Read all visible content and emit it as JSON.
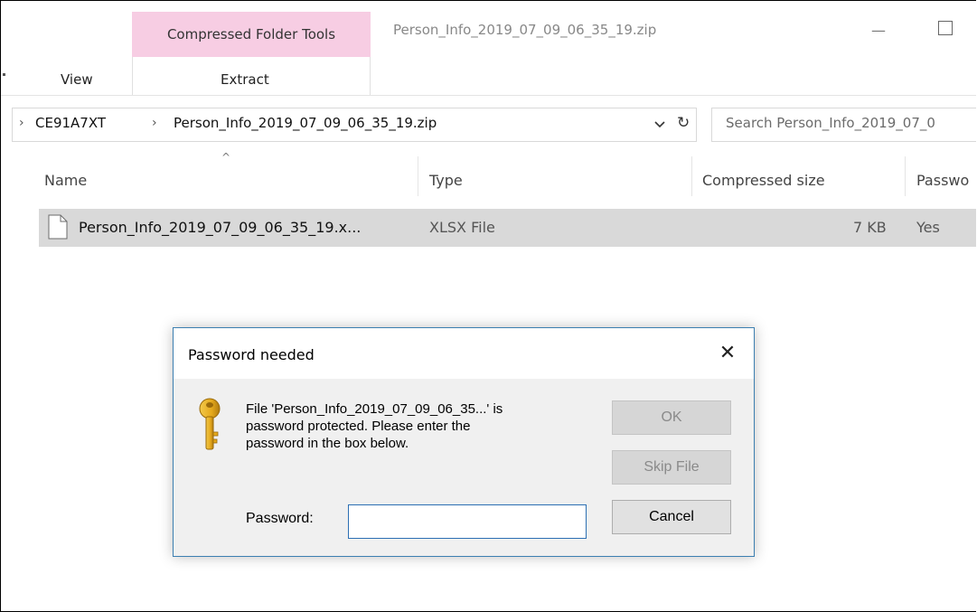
{
  "ribbon": {
    "context_tab_group": "Compressed Folder Tools",
    "window_title": "Person_Info_2019_07_09_06_35_19.zip",
    "tabs": [
      {
        "label": "View"
      },
      {
        "label": "Extract"
      }
    ],
    "context_color": "#f7cde3"
  },
  "address_bar": {
    "breadcrumbs": [
      "CE91A7XT",
      "Person_Info_2019_07_09_06_35_19.zip"
    ]
  },
  "search": {
    "placeholder": "Search Person_Info_2019_07_0"
  },
  "file_list": {
    "columns": [
      "Name",
      "Type",
      "Compressed size",
      "Passwo"
    ],
    "rows": [
      {
        "name": "Person_Info_2019_07_09_06_35_19.x...",
        "type": "XLSX File",
        "compressed_size": "7 KB",
        "password": "Yes"
      }
    ]
  },
  "dialog": {
    "title": "Password needed",
    "message_lines": [
      "File 'Person_Info_2019_07_09_06_35...' is",
      "password protected.  Please enter the",
      "password in the box below."
    ],
    "ok_label": "OK",
    "skip_label": "Skip File",
    "cancel_label": "Cancel",
    "password_label": "Password:",
    "password_value": "",
    "close_glyph": "✕"
  },
  "icons": {
    "window_minimize": "—",
    "refresh": "↻",
    "sort_up": "^",
    "breadcrumb_separator": "›"
  }
}
